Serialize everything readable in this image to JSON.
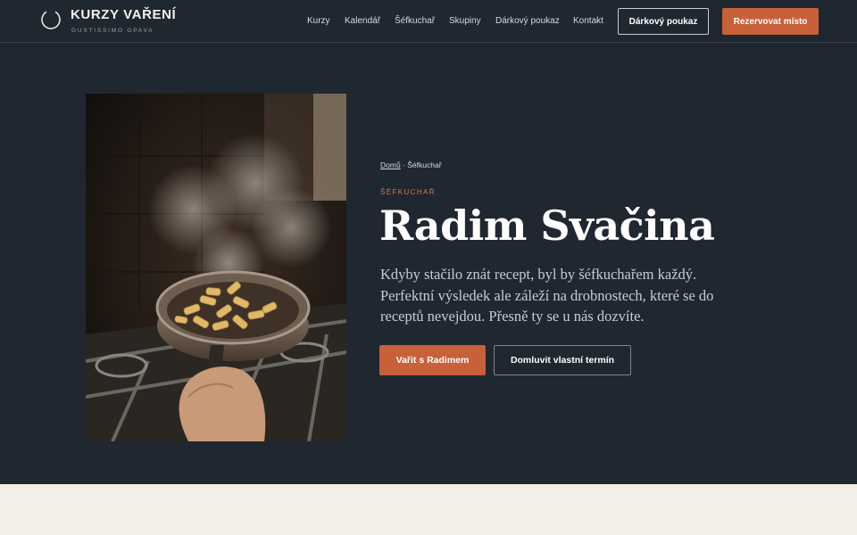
{
  "brand": {
    "title": "KURZY VAŘENÍ",
    "subtitle": "GUSTISSIMO OPAVA"
  },
  "nav": {
    "items": [
      {
        "label": "Kurzy"
      },
      {
        "label": "Kalendář"
      },
      {
        "label": "Šéfkuchař"
      },
      {
        "label": "Skupiny"
      },
      {
        "label": "Dárkový poukaz"
      },
      {
        "label": "Kontakt"
      }
    ],
    "voucher_button": "Dárkový poukaz",
    "reserve_button": "Rezervovat místo"
  },
  "hero": {
    "breadcrumb": {
      "home": "Domů",
      "separator": " · ",
      "current": "Šéfkuchař"
    },
    "eyebrow": "ŠÉFKUCHAŘ",
    "title": "Radim Svačina",
    "text": "Kdyby stačilo znát recept, byl by šéfkuchařem každý. Perfektní výsledek ale záleží na drobnostech, které se do receptů nevejdou. Přesně ty se u nás dozvíte.",
    "primary_button": "Vařit s Radimem",
    "secondary_button": "Domluvit vlastní termín"
  },
  "colors": {
    "header_bg": "#1f2731",
    "hero_bg": "#1f2731",
    "accent": "#c8603a",
    "eyebrow": "#d7794f",
    "page_bg": "#f3efe8"
  },
  "icons": {
    "logo": "circle-logo-icon"
  }
}
